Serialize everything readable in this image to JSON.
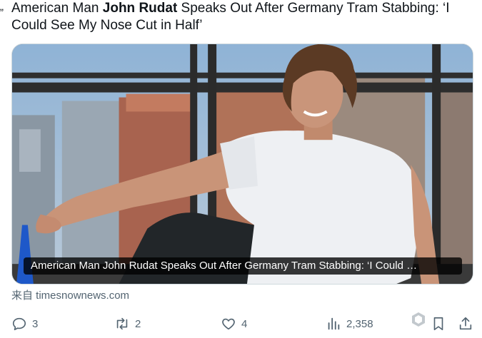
{
  "tweet": {
    "quote_mark": "„",
    "headline_part1": "American Man ",
    "headline_bold": "John Rudat",
    "headline_part2": " Speaks Out After Germany Tram Stabbing: ‘I Could See My Nose Cut in Half’"
  },
  "card": {
    "caption": "American Man John Rudat Speaks Out After Germany Tram Stabbing: ‘I Could …",
    "source": "来自 timesnownews.com"
  },
  "actions": {
    "reply_count": "3",
    "retweet_count": "2",
    "like_count": "4",
    "views_count": "2,358"
  },
  "icons": {
    "reply": "reply-icon",
    "retweet": "retweet-icon",
    "like": "heart-icon",
    "views": "views-chart-icon",
    "bookmark": "bookmark-icon",
    "share": "share-icon"
  },
  "colors": {
    "text": "#0f1419",
    "muted": "#536471",
    "border": "#cfd9de"
  }
}
